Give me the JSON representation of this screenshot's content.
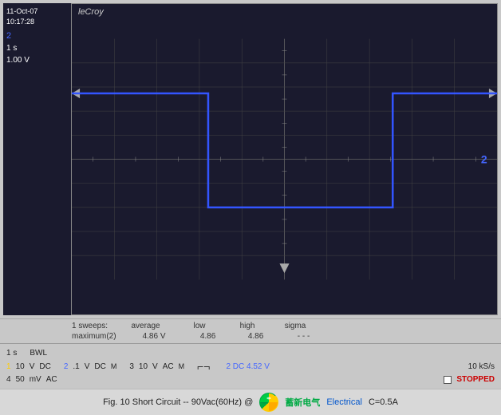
{
  "header": {
    "date": "11-Oct-07",
    "time": "10:17:28"
  },
  "brand": "leCroy",
  "channel": {
    "number": "2",
    "timeScale": "1 s",
    "voltScale": "1.00 V"
  },
  "stats": {
    "label": "1 sweeps:",
    "cols": [
      "average",
      "low",
      "high",
      "sigma"
    ],
    "row1": {
      "metric": "maximum(2)",
      "average": "4.86 V",
      "low": "4.86",
      "high": "4.86",
      "sigma": "- - -"
    }
  },
  "controls": {
    "timeLabel": "1 s",
    "bwlLabel": "BWL",
    "ch1": {
      "num": "1",
      "volt": "10",
      "unit": "V",
      "coupling": "DC"
    },
    "ch2": {
      "num": "2",
      "volt": ".1",
      "unit": "V",
      "coupling": "DC"
    },
    "ch3": {
      "num": "3",
      "volt": "10",
      "unit": "V",
      "coupling": "AC"
    },
    "ch4": {
      "num": "4",
      "volt": "50",
      "unit": "mV",
      "coupling": "AC"
    },
    "sampleRate": "10 kS/s",
    "status": "STOPPED",
    "ch2Info": "2 DC 4.52 V"
  },
  "caption": {
    "text": "Fig. 10  Short Circuit  --  90Vac(60Hz) @",
    "extra": "C=0.5A"
  }
}
